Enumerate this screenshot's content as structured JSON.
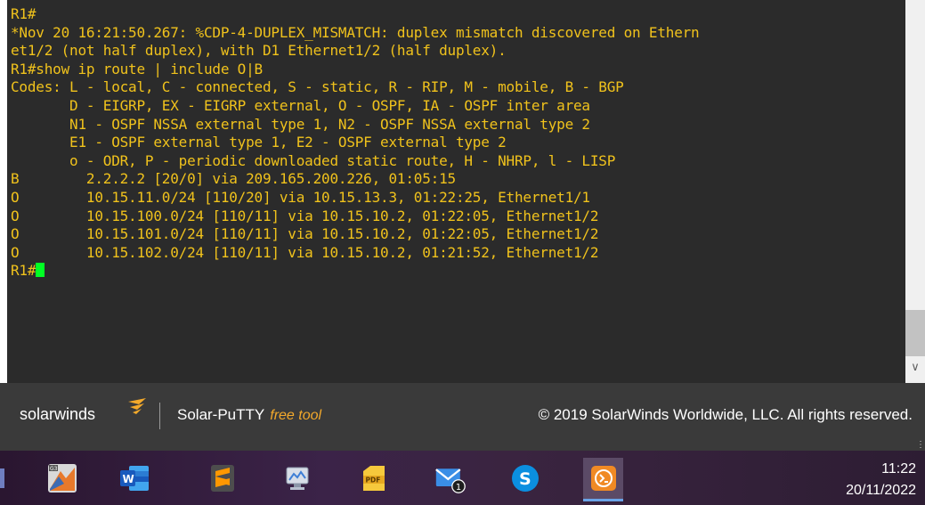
{
  "terminal": {
    "lines": [
      {
        "text": "R1#"
      },
      {
        "text": "*Nov 20 16:21:50.267: %CDP-4-DUPLEX_MISMATCH: duplex mismatch discovered on Ethern"
      },
      {
        "text": "et1/2 (not half duplex), with D1 Ethernet1/2 (half duplex)."
      },
      {
        "text": "R1#show ip route | include O|B"
      },
      {
        "text": "Codes: L - local, C - connected, S - static, R - RIP, M - mobile, B - BGP"
      },
      {
        "text": "       D - EIGRP, EX - EIGRP external, O - OSPF, IA - OSPF inter area"
      },
      {
        "text": "       N1 - OSPF NSSA external type 1, N2 - OSPF NSSA external type 2"
      },
      {
        "text": "       E1 - OSPF external type 1, E2 - OSPF external type 2"
      },
      {
        "text": "       o - ODR, P - periodic downloaded static route, H - NHRP, l - LISP"
      },
      {
        "text": "B        2.2.2.2 [20/0] via 209.165.200.226, 01:05:15"
      },
      {
        "text": "O        10.15.11.0/24 [110/20] via 10.15.13.3, 01:22:25, Ethernet1/1"
      },
      {
        "text": "O        10.15.100.0/24 [110/11] via 10.15.10.2, 01:22:05, Ethernet1/2"
      },
      {
        "text": "O        10.15.101.0/24 [110/11] via 10.15.10.2, 01:22:05, Ethernet1/2"
      },
      {
        "text": "O        10.15.102.0/24 [110/11] via 10.15.10.2, 01:21:52, Ethernet1/2"
      }
    ],
    "prompt": "R1#",
    "text_color": "#f0c21c",
    "cursor_color": "#00ff24",
    "background": "#2b2b2b"
  },
  "footer": {
    "brand": "solarwinds",
    "product": "Solar-PuTTY",
    "tag": "free tool",
    "copyright": "© 2019 SolarWinds Worldwide, LLC. All rights reserved."
  },
  "taskbar": {
    "apps": [
      "gns3-icon",
      "word-icon",
      "sublime-text-icon",
      "monitor-icon",
      "pdf-icon",
      "mail-icon",
      "skype-icon",
      "solar-putty-icon"
    ],
    "mail_badge": "1",
    "time": "11:22",
    "date": "20/11/2022"
  }
}
